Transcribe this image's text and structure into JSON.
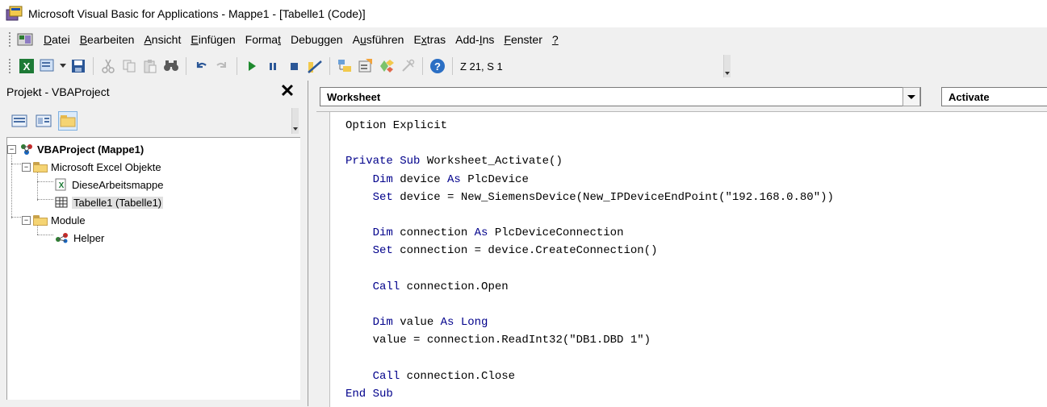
{
  "window": {
    "title": "Microsoft Visual Basic for Applications - Mappe1 - [Tabelle1 (Code)]"
  },
  "menu": {
    "items": [
      {
        "pre": "",
        "key": "D",
        "post": "atei"
      },
      {
        "pre": "",
        "key": "B",
        "post": "earbeiten"
      },
      {
        "pre": "",
        "key": "A",
        "post": "nsicht"
      },
      {
        "pre": "",
        "key": "E",
        "post": "infügen"
      },
      {
        "pre": "Forma",
        "key": "t",
        "post": ""
      },
      {
        "pre": "",
        "key": "",
        "post": "Debuggen"
      },
      {
        "pre": "A",
        "key": "u",
        "post": "sführen"
      },
      {
        "pre": "E",
        "key": "x",
        "post": "tras"
      },
      {
        "pre": "Add-",
        "key": "I",
        "post": "ns"
      },
      {
        "pre": "",
        "key": "F",
        "post": "enster"
      },
      {
        "pre": "",
        "key": "?",
        "post": ""
      }
    ]
  },
  "toolbar": {
    "cursor_position": "Z 21, S 1",
    "icons": [
      "excel-icon",
      "insert-module-icon",
      "save-icon",
      "cut-icon",
      "copy-icon",
      "paste-icon",
      "find-icon",
      "undo-icon",
      "redo-icon",
      "run-icon",
      "break-icon",
      "reset-icon",
      "design-mode-icon",
      "project-explorer-icon",
      "properties-icon",
      "object-browser-icon",
      "toolbox-icon",
      "help-icon"
    ]
  },
  "project": {
    "title": "Projekt - VBAProject",
    "close": "✕",
    "tree": {
      "root": "VBAProject (Mappe1)",
      "excel_folder": "Microsoft Excel Objekte",
      "workbook": "DieseArbeitsmappe",
      "sheet": "Tabelle1 (Tabelle1)",
      "modules_folder": "Module",
      "module": "Helper"
    }
  },
  "code": {
    "object_combo": "Worksheet",
    "procedure_combo": "Activate",
    "lines": [
      [
        {
          "k": false,
          "t": "Option Explicit"
        }
      ],
      [],
      [
        {
          "k": true,
          "t": "Private Sub "
        },
        {
          "k": false,
          "t": "Worksheet_Activate()"
        }
      ],
      [
        {
          "k": false,
          "t": "    "
        },
        {
          "k": true,
          "t": "Dim "
        },
        {
          "k": false,
          "t": "device "
        },
        {
          "k": true,
          "t": "As "
        },
        {
          "k": false,
          "t": "PlcDevice"
        }
      ],
      [
        {
          "k": false,
          "t": "    "
        },
        {
          "k": true,
          "t": "Set "
        },
        {
          "k": false,
          "t": "device = New_SiemensDevice(New_IPDeviceEndPoint(\"192.168.0.80\"))"
        }
      ],
      [],
      [
        {
          "k": false,
          "t": "    "
        },
        {
          "k": true,
          "t": "Dim "
        },
        {
          "k": false,
          "t": "connection "
        },
        {
          "k": true,
          "t": "As "
        },
        {
          "k": false,
          "t": "PlcDeviceConnection"
        }
      ],
      [
        {
          "k": false,
          "t": "    "
        },
        {
          "k": true,
          "t": "Set "
        },
        {
          "k": false,
          "t": "connection = device.CreateConnection()"
        }
      ],
      [],
      [
        {
          "k": false,
          "t": "    "
        },
        {
          "k": true,
          "t": "Call "
        },
        {
          "k": false,
          "t": "connection.Open"
        }
      ],
      [],
      [
        {
          "k": false,
          "t": "    "
        },
        {
          "k": true,
          "t": "Dim "
        },
        {
          "k": false,
          "t": "value "
        },
        {
          "k": true,
          "t": "As Long"
        }
      ],
      [
        {
          "k": false,
          "t": "    value = connection.ReadInt32(\"DB1.DBD 1\")"
        }
      ],
      [],
      [
        {
          "k": false,
          "t": "    "
        },
        {
          "k": true,
          "t": "Call "
        },
        {
          "k": false,
          "t": "connection.Close"
        }
      ],
      [
        {
          "k": true,
          "t": "End Sub"
        }
      ]
    ]
  }
}
